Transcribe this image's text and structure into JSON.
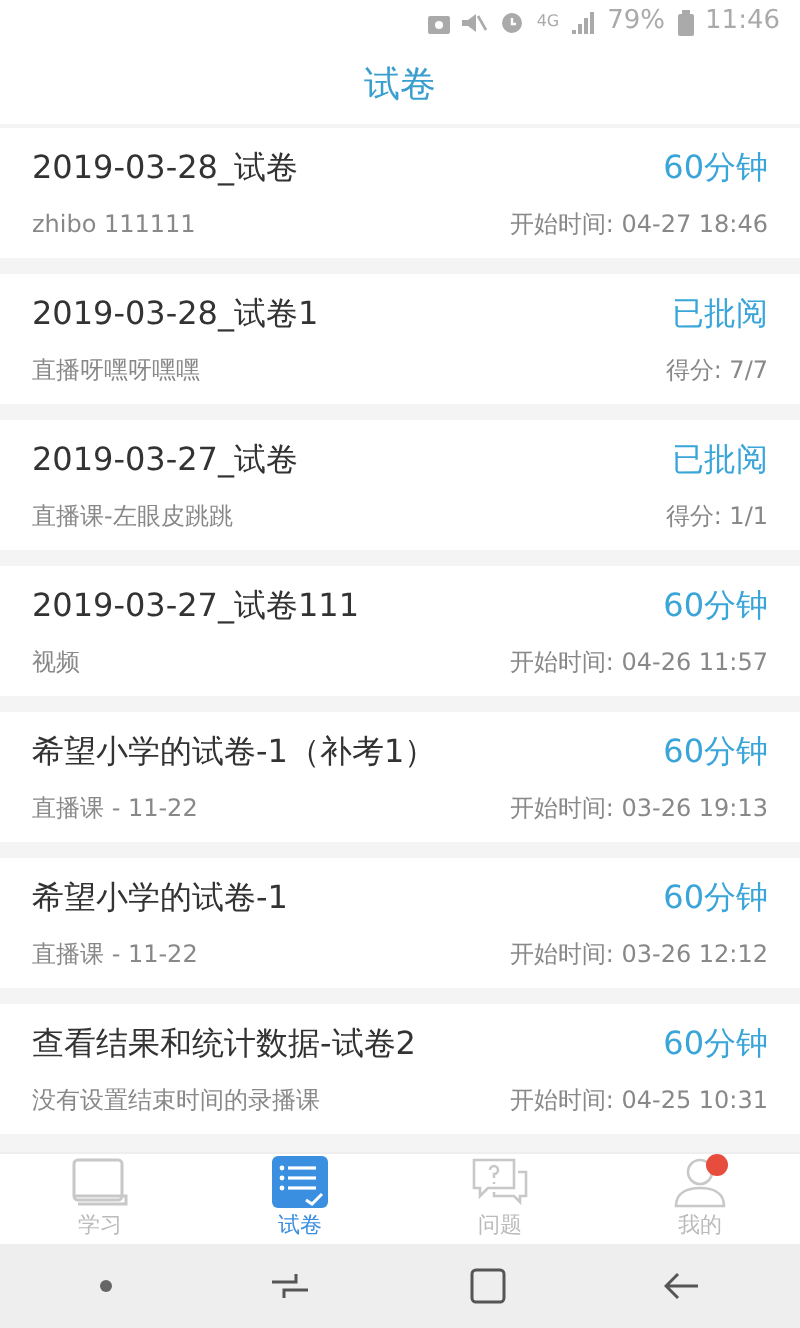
{
  "status_bar": {
    "network": "4G",
    "battery": "79%",
    "time": "11:46"
  },
  "header": {
    "title": "试卷"
  },
  "papers": [
    {
      "title": "2019-03-28_试卷",
      "subtitle": "zhibo 111111",
      "status": "60分钟",
      "detail": "开始时间: 04-27 18:46"
    },
    {
      "title": "2019-03-28_试卷1",
      "subtitle": "直播呀嘿呀嘿嘿",
      "status": "已批阅",
      "detail": "得分: 7/7"
    },
    {
      "title": "2019-03-27_试卷",
      "subtitle": "直播课-左眼皮跳跳",
      "status": "已批阅",
      "detail": "得分: 1/1"
    },
    {
      "title": "2019-03-27_试卷111",
      "subtitle": "视频",
      "status": "60分钟",
      "detail": "开始时间: 04-26 11:57"
    },
    {
      "title": "希望小学的试卷-1（补考1）",
      "subtitle": "直播课 - 11-22",
      "status": "60分钟",
      "detail": "开始时间: 03-26 19:13"
    },
    {
      "title": "希望小学的试卷-1",
      "subtitle": "直播课 - 11-22",
      "status": "60分钟",
      "detail": "开始时间: 03-26 12:12"
    },
    {
      "title": "查看结果和统计数据-试卷2",
      "subtitle": "没有设置结束时间的录播课",
      "status": "60分钟",
      "detail": "开始时间: 04-25 10:31"
    }
  ],
  "tab_bar": [
    {
      "kind": "book",
      "label": "学习",
      "selected": false
    },
    {
      "kind": "list",
      "label": "试卷",
      "selected": true
    },
    {
      "kind": "question",
      "label": "问题",
      "selected": false
    },
    {
      "kind": "person",
      "label": "我的",
      "selected": false,
      "badge": true
    }
  ]
}
